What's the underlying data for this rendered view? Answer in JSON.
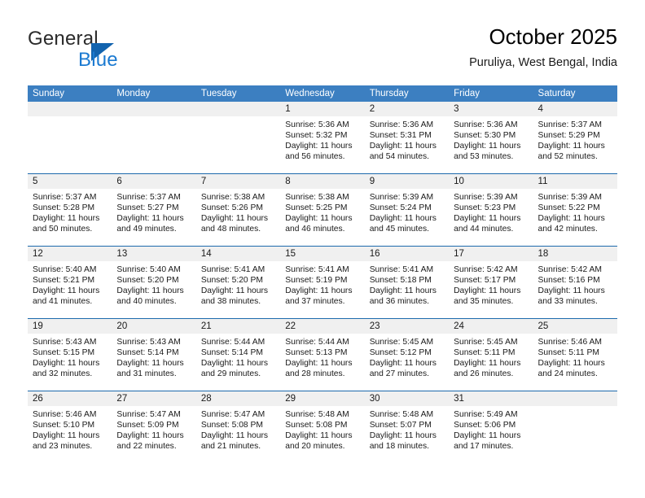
{
  "logo": {
    "word_top": "General",
    "word_bottom": "Blue",
    "triangle_color": "#1263ae",
    "blue_text_color": "#1b7ad1"
  },
  "header": {
    "title": "October 2025",
    "subtitle": "Puruliya, West Bengal, India"
  },
  "theme": {
    "header_bar_color": "#3c7fc1",
    "row_rule_color": "#1d6aad",
    "date_band_color": "#f0f0f0"
  },
  "calendar": {
    "day_headers": [
      "Sunday",
      "Monday",
      "Tuesday",
      "Wednesday",
      "Thursday",
      "Friday",
      "Saturday"
    ],
    "weeks": [
      [
        {
          "day": "",
          "sunrise": "",
          "sunset": "",
          "daylight_1": "",
          "daylight_2": ""
        },
        {
          "day": "",
          "sunrise": "",
          "sunset": "",
          "daylight_1": "",
          "daylight_2": ""
        },
        {
          "day": "",
          "sunrise": "",
          "sunset": "",
          "daylight_1": "",
          "daylight_2": ""
        },
        {
          "day": "1",
          "sunrise": "Sunrise: 5:36 AM",
          "sunset": "Sunset: 5:32 PM",
          "daylight_1": "Daylight: 11 hours",
          "daylight_2": "and 56 minutes."
        },
        {
          "day": "2",
          "sunrise": "Sunrise: 5:36 AM",
          "sunset": "Sunset: 5:31 PM",
          "daylight_1": "Daylight: 11 hours",
          "daylight_2": "and 54 minutes."
        },
        {
          "day": "3",
          "sunrise": "Sunrise: 5:36 AM",
          "sunset": "Sunset: 5:30 PM",
          "daylight_1": "Daylight: 11 hours",
          "daylight_2": "and 53 minutes."
        },
        {
          "day": "4",
          "sunrise": "Sunrise: 5:37 AM",
          "sunset": "Sunset: 5:29 PM",
          "daylight_1": "Daylight: 11 hours",
          "daylight_2": "and 52 minutes."
        }
      ],
      [
        {
          "day": "5",
          "sunrise": "Sunrise: 5:37 AM",
          "sunset": "Sunset: 5:28 PM",
          "daylight_1": "Daylight: 11 hours",
          "daylight_2": "and 50 minutes."
        },
        {
          "day": "6",
          "sunrise": "Sunrise: 5:37 AM",
          "sunset": "Sunset: 5:27 PM",
          "daylight_1": "Daylight: 11 hours",
          "daylight_2": "and 49 minutes."
        },
        {
          "day": "7",
          "sunrise": "Sunrise: 5:38 AM",
          "sunset": "Sunset: 5:26 PM",
          "daylight_1": "Daylight: 11 hours",
          "daylight_2": "and 48 minutes."
        },
        {
          "day": "8",
          "sunrise": "Sunrise: 5:38 AM",
          "sunset": "Sunset: 5:25 PM",
          "daylight_1": "Daylight: 11 hours",
          "daylight_2": "and 46 minutes."
        },
        {
          "day": "9",
          "sunrise": "Sunrise: 5:39 AM",
          "sunset": "Sunset: 5:24 PM",
          "daylight_1": "Daylight: 11 hours",
          "daylight_2": "and 45 minutes."
        },
        {
          "day": "10",
          "sunrise": "Sunrise: 5:39 AM",
          "sunset": "Sunset: 5:23 PM",
          "daylight_1": "Daylight: 11 hours",
          "daylight_2": "and 44 minutes."
        },
        {
          "day": "11",
          "sunrise": "Sunrise: 5:39 AM",
          "sunset": "Sunset: 5:22 PM",
          "daylight_1": "Daylight: 11 hours",
          "daylight_2": "and 42 minutes."
        }
      ],
      [
        {
          "day": "12",
          "sunrise": "Sunrise: 5:40 AM",
          "sunset": "Sunset: 5:21 PM",
          "daylight_1": "Daylight: 11 hours",
          "daylight_2": "and 41 minutes."
        },
        {
          "day": "13",
          "sunrise": "Sunrise: 5:40 AM",
          "sunset": "Sunset: 5:20 PM",
          "daylight_1": "Daylight: 11 hours",
          "daylight_2": "and 40 minutes."
        },
        {
          "day": "14",
          "sunrise": "Sunrise: 5:41 AM",
          "sunset": "Sunset: 5:20 PM",
          "daylight_1": "Daylight: 11 hours",
          "daylight_2": "and 38 minutes."
        },
        {
          "day": "15",
          "sunrise": "Sunrise: 5:41 AM",
          "sunset": "Sunset: 5:19 PM",
          "daylight_1": "Daylight: 11 hours",
          "daylight_2": "and 37 minutes."
        },
        {
          "day": "16",
          "sunrise": "Sunrise: 5:41 AM",
          "sunset": "Sunset: 5:18 PM",
          "daylight_1": "Daylight: 11 hours",
          "daylight_2": "and 36 minutes."
        },
        {
          "day": "17",
          "sunrise": "Sunrise: 5:42 AM",
          "sunset": "Sunset: 5:17 PM",
          "daylight_1": "Daylight: 11 hours",
          "daylight_2": "and 35 minutes."
        },
        {
          "day": "18",
          "sunrise": "Sunrise: 5:42 AM",
          "sunset": "Sunset: 5:16 PM",
          "daylight_1": "Daylight: 11 hours",
          "daylight_2": "and 33 minutes."
        }
      ],
      [
        {
          "day": "19",
          "sunrise": "Sunrise: 5:43 AM",
          "sunset": "Sunset: 5:15 PM",
          "daylight_1": "Daylight: 11 hours",
          "daylight_2": "and 32 minutes."
        },
        {
          "day": "20",
          "sunrise": "Sunrise: 5:43 AM",
          "sunset": "Sunset: 5:14 PM",
          "daylight_1": "Daylight: 11 hours",
          "daylight_2": "and 31 minutes."
        },
        {
          "day": "21",
          "sunrise": "Sunrise: 5:44 AM",
          "sunset": "Sunset: 5:14 PM",
          "daylight_1": "Daylight: 11 hours",
          "daylight_2": "and 29 minutes."
        },
        {
          "day": "22",
          "sunrise": "Sunrise: 5:44 AM",
          "sunset": "Sunset: 5:13 PM",
          "daylight_1": "Daylight: 11 hours",
          "daylight_2": "and 28 minutes."
        },
        {
          "day": "23",
          "sunrise": "Sunrise: 5:45 AM",
          "sunset": "Sunset: 5:12 PM",
          "daylight_1": "Daylight: 11 hours",
          "daylight_2": "and 27 minutes."
        },
        {
          "day": "24",
          "sunrise": "Sunrise: 5:45 AM",
          "sunset": "Sunset: 5:11 PM",
          "daylight_1": "Daylight: 11 hours",
          "daylight_2": "and 26 minutes."
        },
        {
          "day": "25",
          "sunrise": "Sunrise: 5:46 AM",
          "sunset": "Sunset: 5:11 PM",
          "daylight_1": "Daylight: 11 hours",
          "daylight_2": "and 24 minutes."
        }
      ],
      [
        {
          "day": "26",
          "sunrise": "Sunrise: 5:46 AM",
          "sunset": "Sunset: 5:10 PM",
          "daylight_1": "Daylight: 11 hours",
          "daylight_2": "and 23 minutes."
        },
        {
          "day": "27",
          "sunrise": "Sunrise: 5:47 AM",
          "sunset": "Sunset: 5:09 PM",
          "daylight_1": "Daylight: 11 hours",
          "daylight_2": "and 22 minutes."
        },
        {
          "day": "28",
          "sunrise": "Sunrise: 5:47 AM",
          "sunset": "Sunset: 5:08 PM",
          "daylight_1": "Daylight: 11 hours",
          "daylight_2": "and 21 minutes."
        },
        {
          "day": "29",
          "sunrise": "Sunrise: 5:48 AM",
          "sunset": "Sunset: 5:08 PM",
          "daylight_1": "Daylight: 11 hours",
          "daylight_2": "and 20 minutes."
        },
        {
          "day": "30",
          "sunrise": "Sunrise: 5:48 AM",
          "sunset": "Sunset: 5:07 PM",
          "daylight_1": "Daylight: 11 hours",
          "daylight_2": "and 18 minutes."
        },
        {
          "day": "31",
          "sunrise": "Sunrise: 5:49 AM",
          "sunset": "Sunset: 5:06 PM",
          "daylight_1": "Daylight: 11 hours",
          "daylight_2": "and 17 minutes."
        },
        {
          "day": "",
          "sunrise": "",
          "sunset": "",
          "daylight_1": "",
          "daylight_2": ""
        }
      ]
    ]
  }
}
